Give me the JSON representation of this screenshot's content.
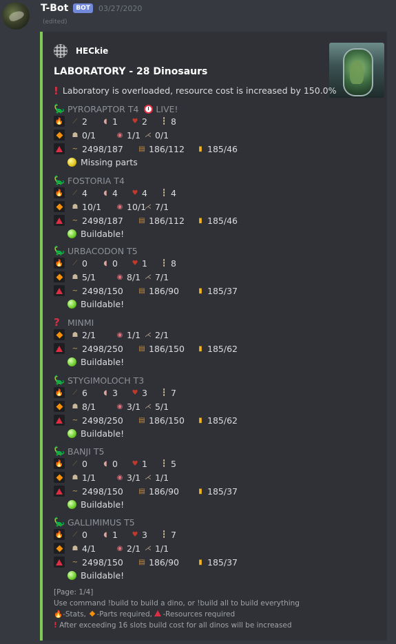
{
  "message": {
    "username": "T-Bot",
    "badge": "BOT",
    "timestamp": "03/27/2020",
    "edited": "(edited)"
  },
  "embed": {
    "accent_color": "#7ecb53",
    "author": "HECkie",
    "title": "LABORATORY - 28 Dinosaurs",
    "warning": "Laboratory is overloaded, resource cost is increased by 150.0%",
    "dinos": [
      {
        "name": "PYRORAPTOR T4",
        "live": "LIVE!",
        "stats": [
          "2",
          "1",
          "2",
          "8"
        ],
        "parts": [
          "0/1",
          "1/1",
          "0/1"
        ],
        "resources": [
          "2498/187",
          "186/112",
          "185/46"
        ],
        "status": "Missing parts",
        "status_color": "yellow"
      },
      {
        "name": "FOSTORIA T4",
        "stats": [
          "4",
          "4",
          "4",
          "4"
        ],
        "parts": [
          "10/1",
          "10/1",
          "7/1"
        ],
        "resources": [
          "2498/187",
          "186/112",
          "185/46"
        ],
        "status": "Buildable!",
        "status_color": "green"
      },
      {
        "name": "URBACODON T5",
        "stats": [
          "0",
          "0",
          "1",
          "8"
        ],
        "parts": [
          "5/1",
          "8/1",
          "7/1"
        ],
        "resources": [
          "2498/150",
          "186/90",
          "185/37"
        ],
        "status": "Buildable!",
        "status_color": "green"
      },
      {
        "name": "MINMI",
        "unknown": true,
        "parts": [
          "2/1",
          "1/1",
          "2/1"
        ],
        "resources": [
          "2498/250",
          "186/150",
          "185/62"
        ],
        "status": "Buildable!",
        "status_color": "green"
      },
      {
        "name": "STYGIMOLOCH T3",
        "stats": [
          "6",
          "3",
          "3",
          "7"
        ],
        "parts": [
          "8/1",
          "3/1",
          "5/1"
        ],
        "resources": [
          "2498/250",
          "186/150",
          "185/62"
        ],
        "status": "Buildable!",
        "status_color": "green"
      },
      {
        "name": "BANJI T5",
        "stats": [
          "0",
          "0",
          "1",
          "5"
        ],
        "parts": [
          "1/1",
          "3/1",
          "1/1"
        ],
        "resources": [
          "2498/150",
          "186/90",
          "185/37"
        ],
        "status": "Buildable!",
        "status_color": "green"
      },
      {
        "name": "GALLIMIMUS T5",
        "stats": [
          "0",
          "1",
          "3",
          "7"
        ],
        "parts": [
          "4/1",
          "2/1",
          "1/1"
        ],
        "resources": [
          "2498/150",
          "186/90",
          "185/37"
        ],
        "status": "Buildable!",
        "status_color": "green"
      }
    ],
    "footer": {
      "page": "[Page: 1/4]",
      "usage": "Use command !build to build a dino, or !build all to build everything",
      "legend_stats": "-Stats,",
      "legend_parts": "-Parts required,",
      "legend_resources": "-Resources required",
      "note": "After exceeding 16 slots build cost for all dinos will be increased"
    }
  }
}
